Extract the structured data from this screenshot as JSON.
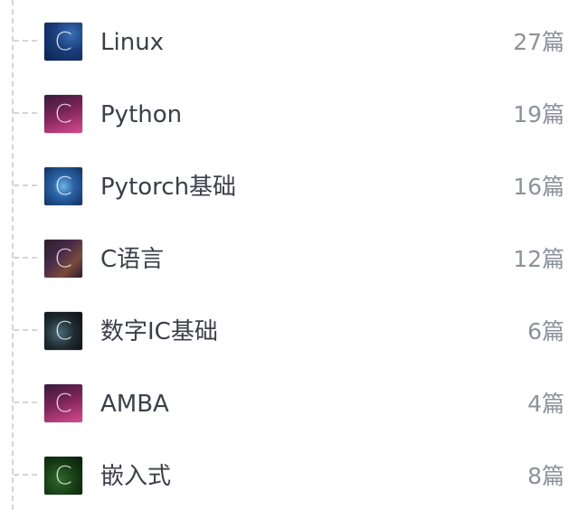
{
  "columns": [
    {
      "name": "Linux",
      "count": "27篇",
      "thumb_icon": "linux-cover-icon",
      "thumb_letter": "C"
    },
    {
      "name": "Python",
      "count": "19篇",
      "thumb_icon": "python-cover-icon",
      "thumb_letter": "C"
    },
    {
      "name": "Pytorch基础",
      "count": "16篇",
      "thumb_icon": "pytorch-cover-icon",
      "thumb_letter": "C"
    },
    {
      "name": "C语言",
      "count": "12篇",
      "thumb_icon": "c-language-cover-icon",
      "thumb_letter": "C"
    },
    {
      "name": "数字IC基础",
      "count": "6篇",
      "thumb_icon": "digital-ic-cover-icon",
      "thumb_letter": "C"
    },
    {
      "name": "AMBA",
      "count": "4篇",
      "thumb_icon": "amba-cover-icon",
      "thumb_letter": "C"
    },
    {
      "name": "嵌入式",
      "count": "8篇",
      "thumb_icon": "embedded-cover-icon",
      "thumb_letter": "C"
    }
  ],
  "colors": {
    "name_text": "#3b3f47",
    "count_text": "#8d919b",
    "tree_line": "#d3d5da"
  }
}
